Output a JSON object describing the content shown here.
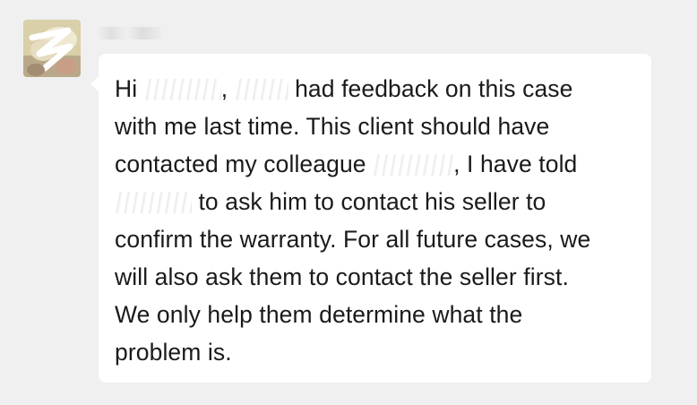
{
  "sender": {
    "name": "W…y"
  },
  "message": {
    "line1_pre": "Hi ",
    "line1_mid": ", ",
    "line1_post": " had feedback on this case",
    "line2": "with me last time. This client should have",
    "line3_pre": "contacted my colleague ",
    "line3_post": ", I have told",
    "line4_post": " to ask him to contact his seller to",
    "line5": "confirm the warranty. For all future cases, we",
    "line6": "will also ask them to contact the seller first.",
    "line7": "We only help them determine what the",
    "line8": "problem is."
  },
  "colors": {
    "background": "#f0f0f0",
    "bubble": "#ffffff",
    "text": "#1a1a1a"
  }
}
